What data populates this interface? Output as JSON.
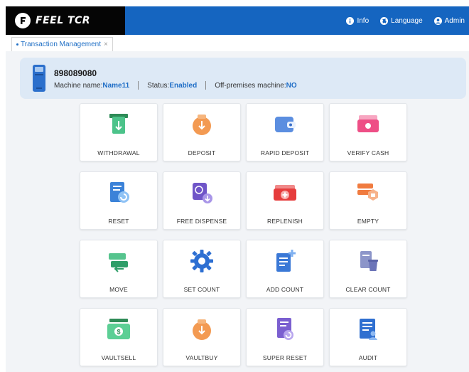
{
  "header": {
    "brand": "FEEL TCR",
    "nav": [
      {
        "label": "Info",
        "icon": "info-icon"
      },
      {
        "label": "Language",
        "icon": "globe-icon"
      },
      {
        "label": "Admin",
        "icon": "user-icon"
      }
    ]
  },
  "tabs": [
    {
      "label": "Transaction Management",
      "active": true
    }
  ],
  "machine": {
    "id": "898089080",
    "name_label": "Machine name:",
    "name_value": "Name11",
    "status_label": "Status:",
    "status_value": "Enabled",
    "offprem_label": "Off-premises machine:",
    "offprem_value": "NO"
  },
  "actions": [
    {
      "label": "WITHDRAWAL",
      "icon": "withdrawal-icon"
    },
    {
      "label": "DEPOSIT",
      "icon": "deposit-icon"
    },
    {
      "label": "RAPID DEPOSIT",
      "icon": "rapid-deposit-icon"
    },
    {
      "label": "VERIFY CASH",
      "icon": "verify-cash-icon"
    },
    {
      "label": "RESET",
      "icon": "reset-icon"
    },
    {
      "label": "FREE DISPENSE",
      "icon": "free-dispense-icon"
    },
    {
      "label": "REPLENISH",
      "icon": "replenish-icon"
    },
    {
      "label": "EMPTY",
      "icon": "empty-icon"
    },
    {
      "label": "MOVE",
      "icon": "move-icon"
    },
    {
      "label": "SET COUNT",
      "icon": "gear-icon"
    },
    {
      "label": "ADD COUNT",
      "icon": "add-count-icon"
    },
    {
      "label": "CLEAR COUNT",
      "icon": "clear-count-icon"
    },
    {
      "label": "VAULTSELL",
      "icon": "vaultsell-icon"
    },
    {
      "label": "VAULTBUY",
      "icon": "vaultbuy-icon"
    },
    {
      "label": "SUPER RESET",
      "icon": "super-reset-icon"
    },
    {
      "label": "AUDIT",
      "icon": "audit-icon"
    }
  ],
  "colors": {
    "header": "#1565c0",
    "brand_bg": "#050505",
    "accent": "#1e6dc6",
    "card_bg": "#dde9f6"
  }
}
